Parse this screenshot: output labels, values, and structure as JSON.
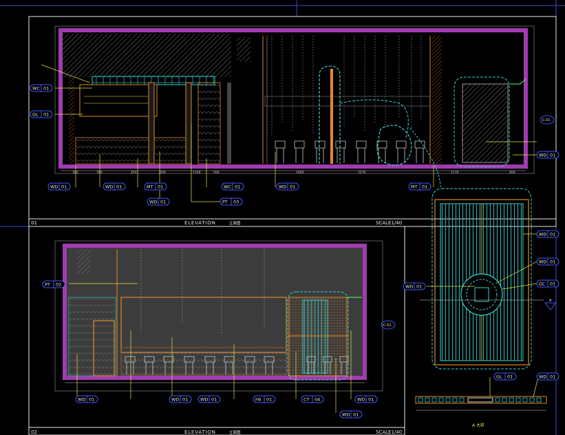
{
  "frame": {
    "top": {
      "number": "01",
      "title": "ELEVATION",
      "subtitle": "立面图",
      "scale": "SCALE1/40"
    },
    "bottom": {
      "number": "02",
      "title": "ELEVATION",
      "subtitle": "立面图",
      "scale": "SCALE1/40"
    }
  },
  "tags": {
    "t1": {
      "code": "WC",
      "num": "01"
    },
    "t2": {
      "code": "GL",
      "num": "01"
    },
    "t3": {
      "code": "WD",
      "num": "01"
    },
    "t4": {
      "code": "WD",
      "num": "01"
    },
    "t5": {
      "code": "MT",
      "num": "01"
    },
    "t6": {
      "code": "WD",
      "num": "01"
    },
    "t7": {
      "code": "WC",
      "num": "01"
    },
    "t8": {
      "code": "PT",
      "num": "03"
    },
    "t9": {
      "code": "WD",
      "num": "01"
    },
    "t10": {
      "code": "MT",
      "num": "01"
    },
    "t11": {
      "code": "WD",
      "num": "01"
    },
    "t12": {
      "code": "PT",
      "num": "02"
    },
    "t13": {
      "code": "WD",
      "num": "01"
    },
    "t14": {
      "code": "WD",
      "num": "01"
    },
    "t15": {
      "code": "WD",
      "num": "01"
    },
    "t16": {
      "code": "FB",
      "num": "01"
    },
    "t17": {
      "code": "CT",
      "num": "04"
    },
    "t18": {
      "code": "WD",
      "num": "01"
    },
    "t19": {
      "code": "WD",
      "num": "01"
    },
    "t20": {
      "code": "WD",
      "num": "01"
    },
    "t21": {
      "code": "WD",
      "num": "01"
    },
    "t22": {
      "code": "WD",
      "num": "01"
    },
    "t23": {
      "code": "GL",
      "num": "01"
    },
    "t24": {
      "code": "GL",
      "num": "01"
    },
    "t25": {
      "code": "WD",
      "num": "01"
    }
  },
  "section_marks": {
    "right_top": "C-01",
    "right_bottom": "C-01"
  },
  "detail": {
    "label": "A 大样",
    "marker": "A"
  },
  "colors": {
    "wall": "#a03cb0",
    "frame": "#ffffff",
    "cyan": "#35d4d4",
    "orange": "#e28a2a",
    "yellow": "#e6e64a",
    "tag": "#3f58ff"
  }
}
